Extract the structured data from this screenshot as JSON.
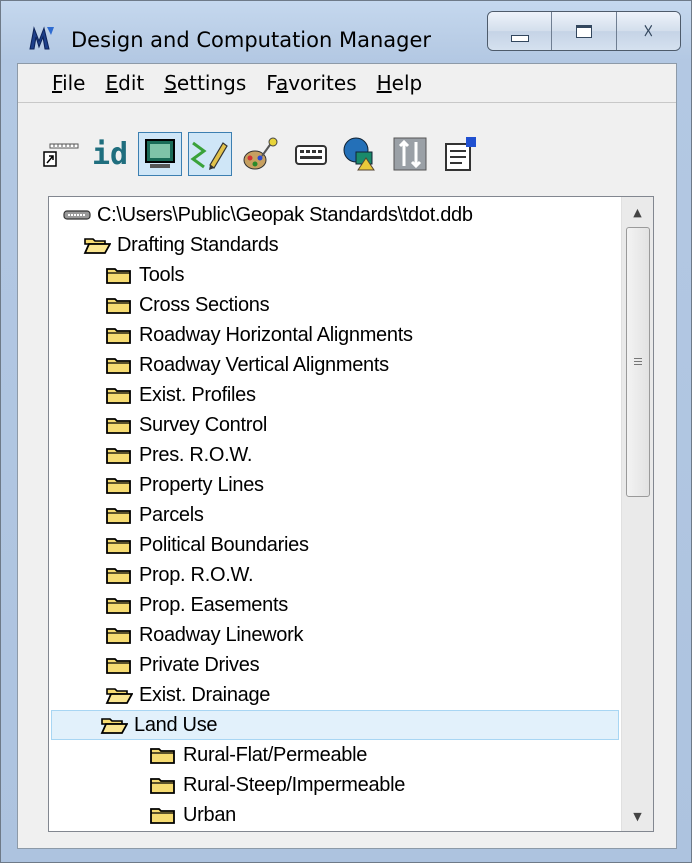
{
  "window": {
    "title": "Design and Computation Manager",
    "accent": "#b9cde6"
  },
  "caption_buttons": {
    "minimize_icon": "minimize-icon",
    "maximize_icon": "maximize-icon",
    "close_glyph": "☓"
  },
  "menu": [
    {
      "underline": "F",
      "rest": "ile"
    },
    {
      "underline": "E",
      "rest": "dit"
    },
    {
      "underline": "S",
      "rest": "ettings"
    },
    {
      "pre": "F",
      "underline": "a",
      "rest": "vorites"
    },
    {
      "underline": "H",
      "rest": "elp"
    }
  ],
  "toolbar": {
    "id_label": "id",
    "buttons": [
      "place-tool-icon",
      "identify-icon",
      "display-mode-icon",
      "draw-mode-icon",
      "color-palette-icon",
      "keyin-icon",
      "shapes-icon",
      "adjust-icon",
      "properties-icon"
    ],
    "pressed": [
      "display-mode-icon",
      "draw-mode-icon"
    ]
  },
  "tree": {
    "root": "C:\\Users\\Public\\Geopak Standards\\tdot.ddb",
    "drafting_standards": "Drafting Standards",
    "children": [
      "Tools",
      "Cross Sections",
      "Roadway Horizontal Alignments",
      "Roadway Vertical Alignments",
      "Exist. Profiles",
      "Survey Control",
      "Pres. R.O.W.",
      "Property Lines",
      "Parcels",
      "Political Boundaries",
      "Prop. R.O.W.",
      "Prop. Easements",
      "Roadway Linework",
      "Private Drives"
    ],
    "exist_drainage": "Exist. Drainage",
    "land_use": "Land Use",
    "land_use_children": [
      "Rural-Flat/Permeable",
      "Rural-Steep/Impermeable",
      "Urban"
    ],
    "selected": "Land Use",
    "folder_color": "#f5d86a",
    "selection_color": "#e2f1fb"
  },
  "scrollbar": {
    "up_glyph": "▲",
    "down_glyph": "▼",
    "position_fraction": 0.0
  }
}
